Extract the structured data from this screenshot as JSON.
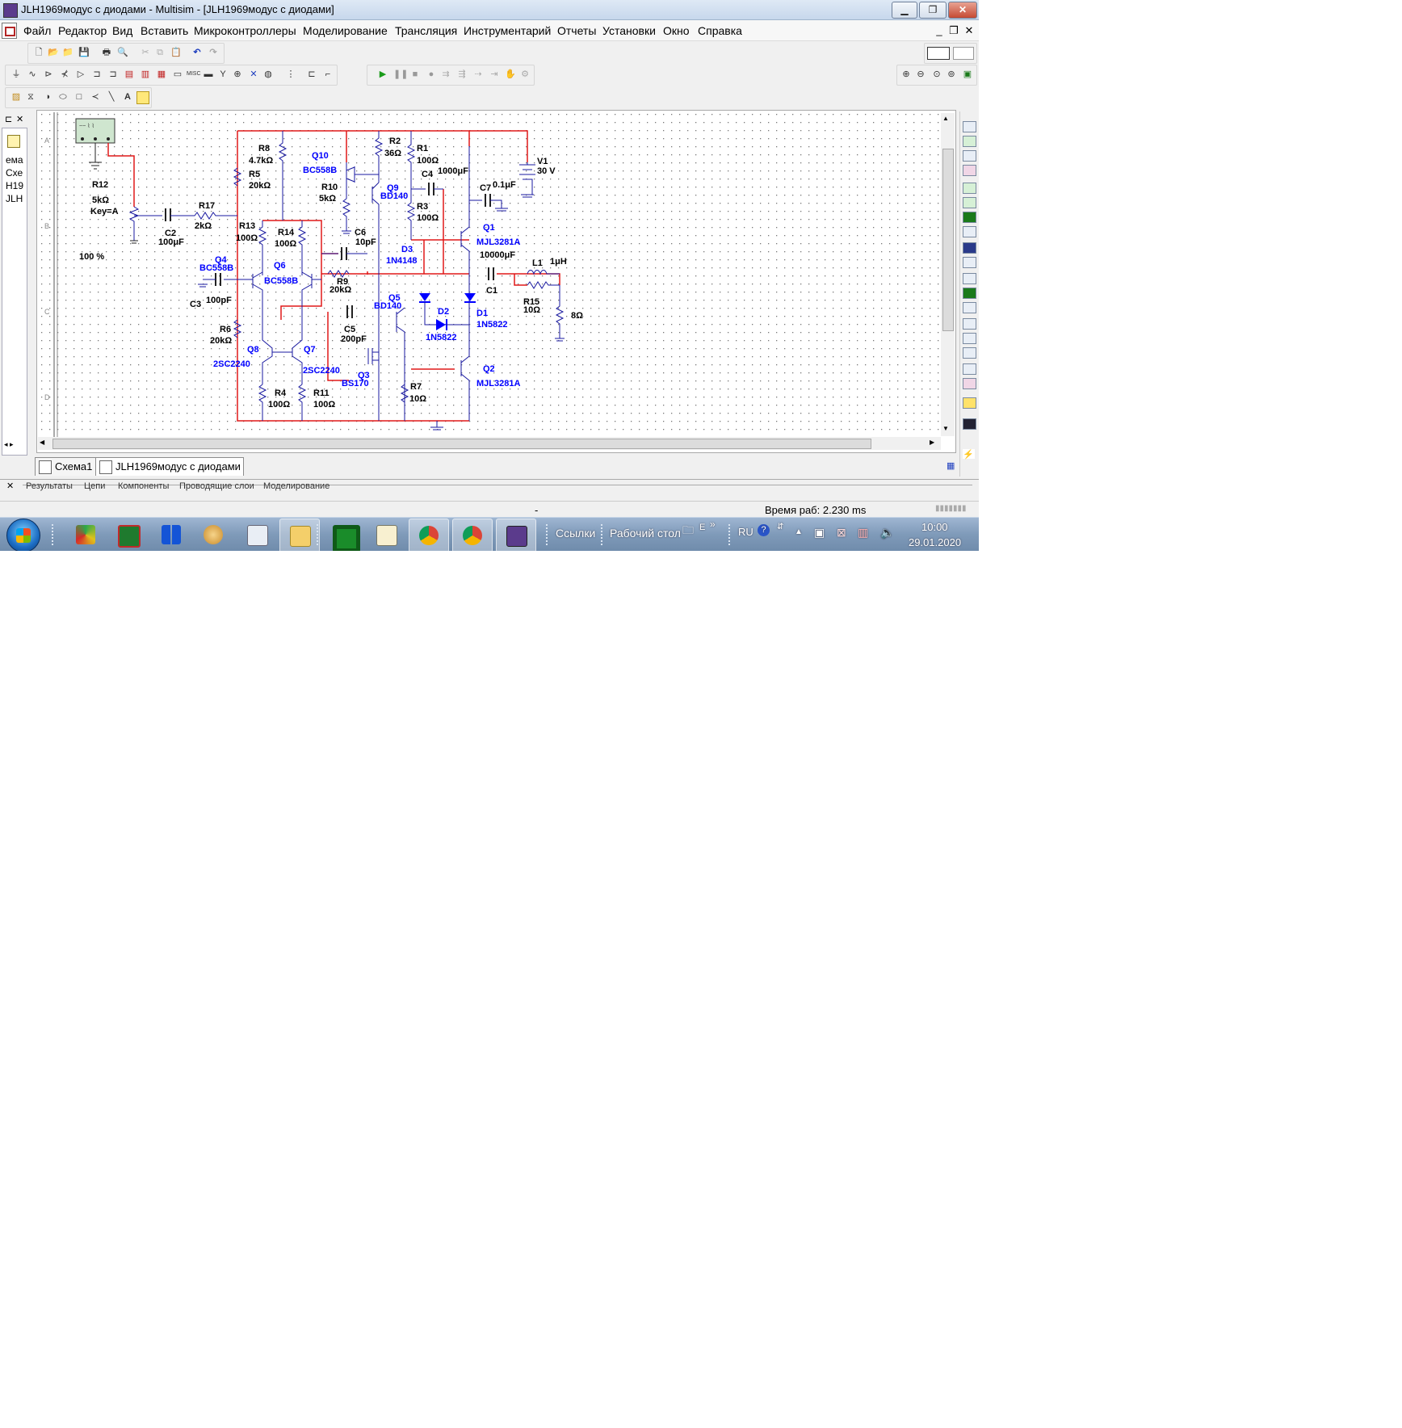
{
  "window": {
    "title": "JLH1969модус с диодами - Multisim - [JLH1969модус с диодами]",
    "minimize": "▁",
    "restore": "❐",
    "close": "✕"
  },
  "menu": {
    "items": [
      "Файл",
      "Редактор",
      "Вид",
      "Вставить",
      "Микроконтроллеры",
      "Моделирование",
      "Трансляция",
      "Инструментарий",
      "Отчеты",
      "Установки",
      "Окно",
      "Справка"
    ],
    "mdi_minimize": "_",
    "mdi_restore": "❐",
    "mdi_close": "✕"
  },
  "toolbar_icons": {
    "file": [
      "new-icon",
      "open-icon",
      "open-folder-icon",
      "save-icon",
      "print-icon",
      "print-preview-icon",
      "cut-icon",
      "copy-icon",
      "paste-icon",
      "undo-icon",
      "redo-icon"
    ],
    "simulation": [
      "run-icon",
      "pause-icon",
      "stop-icon",
      "record-icon"
    ],
    "colors": {
      "run": "#1a9b1a",
      "undo": "#1f3fbf",
      "accent_red": "#e01818",
      "wire_blue": "#0000ff"
    }
  },
  "left_panel": {
    "lines": [
      "ема",
      "Схе",
      "H19",
      "JLH"
    ]
  },
  "canvas": {
    "probe_percent": "100 %",
    "ruler_rows": [
      "A",
      "B",
      "C",
      "D"
    ]
  },
  "schematic": {
    "labels": [
      {
        "id": "R12",
        "t": "R12"
      },
      {
        "id": "R12v",
        "t": "5kΩ"
      },
      {
        "id": "R12k",
        "t": "Key=A"
      },
      {
        "id": "C2",
        "t": "C2"
      },
      {
        "id": "C2v",
        "t": "100μF"
      },
      {
        "id": "R17",
        "t": "R17"
      },
      {
        "id": "R17v",
        "t": "2kΩ"
      },
      {
        "id": "R8",
        "t": "R8"
      },
      {
        "id": "R8v",
        "t": "4.7kΩ"
      },
      {
        "id": "R5",
        "t": "R5"
      },
      {
        "id": "R5v",
        "t": "20kΩ"
      },
      {
        "id": "R13",
        "t": "R13"
      },
      {
        "id": "R13v",
        "t": "100Ω"
      },
      {
        "id": "R14",
        "t": "R14"
      },
      {
        "id": "R14v",
        "t": "100Ω"
      },
      {
        "id": "Q4",
        "t": "Q4"
      },
      {
        "id": "Q4v",
        "t": "BC558B"
      },
      {
        "id": "Q6",
        "t": "Q6"
      },
      {
        "id": "Q6v",
        "t": "BC558B"
      },
      {
        "id": "C3",
        "t": "C3"
      },
      {
        "id": "C3v",
        "t": "100pF"
      },
      {
        "id": "R6",
        "t": "R6"
      },
      {
        "id": "R6v",
        "t": "20kΩ"
      },
      {
        "id": "Q8",
        "t": "Q8"
      },
      {
        "id": "Q8v",
        "t": "2SC2240"
      },
      {
        "id": "Q7",
        "t": "Q7"
      },
      {
        "id": "Q7v",
        "t": "2SC2240"
      },
      {
        "id": "R4",
        "t": "R4"
      },
      {
        "id": "R4v",
        "t": "100Ω"
      },
      {
        "id": "R11",
        "t": "R11"
      },
      {
        "id": "R11v",
        "t": "100Ω"
      },
      {
        "id": "Q10",
        "t": "Q10"
      },
      {
        "id": "Q10v",
        "t": "BC558B"
      },
      {
        "id": "R10",
        "t": "R10"
      },
      {
        "id": "R10v",
        "t": "5kΩ"
      },
      {
        "id": "R2",
        "t": "R2"
      },
      {
        "id": "R2v",
        "t": "36Ω"
      },
      {
        "id": "Q9",
        "t": "Q9"
      },
      {
        "id": "Q9v",
        "t": "BD140"
      },
      {
        "id": "C6",
        "t": "C6"
      },
      {
        "id": "C6v",
        "t": "10pF"
      },
      {
        "id": "R9",
        "t": "R9"
      },
      {
        "id": "R9v",
        "t": "20kΩ"
      },
      {
        "id": "C5",
        "t": "C5"
      },
      {
        "id": "C5v",
        "t": "200pF"
      },
      {
        "id": "Q5",
        "t": "Q5"
      },
      {
        "id": "Q5v",
        "t": "BD140"
      },
      {
        "id": "Q3",
        "t": "Q3"
      },
      {
        "id": "Q3v",
        "t": "BS170"
      },
      {
        "id": "R1",
        "t": "R1"
      },
      {
        "id": "R1v",
        "t": "100Ω"
      },
      {
        "id": "C4",
        "t": "C4"
      },
      {
        "id": "C4v",
        "t": "1000μF"
      },
      {
        "id": "R3",
        "t": "R3"
      },
      {
        "id": "R3v",
        "t": "100Ω"
      },
      {
        "id": "D3",
        "t": "D3"
      },
      {
        "id": "D3v",
        "t": "1N4148"
      },
      {
        "id": "D2",
        "t": "D2"
      },
      {
        "id": "D2v",
        "t": "1N5822"
      },
      {
        "id": "R7",
        "t": "R7"
      },
      {
        "id": "R7v",
        "t": "10Ω"
      },
      {
        "id": "Q1",
        "t": "Q1"
      },
      {
        "id": "Q1v",
        "t": "MJL3281A"
      },
      {
        "id": "Q2",
        "t": "Q2"
      },
      {
        "id": "Q2v",
        "t": "MJL3281A"
      },
      {
        "id": "D1",
        "t": "D1"
      },
      {
        "id": "D1v",
        "t": "1N5822"
      },
      {
        "id": "C7",
        "t": "C7"
      },
      {
        "id": "C7v",
        "t": "0.1μF"
      },
      {
        "id": "V1",
        "t": "V1"
      },
      {
        "id": "V1v",
        "t": "30 V"
      },
      {
        "id": "C1",
        "t": "C1"
      },
      {
        "id": "C1v",
        "t": "10000μF"
      },
      {
        "id": "L1",
        "t": "L1"
      },
      {
        "id": "L1v",
        "t": "1μH"
      },
      {
        "id": "R15",
        "t": "R15"
      },
      {
        "id": "R15v",
        "t": "10Ω"
      },
      {
        "id": "RL",
        "t": "8Ω"
      }
    ]
  },
  "doc_tabs": [
    "Схема1",
    "JLH1969модус с диодами"
  ],
  "bottom_tabs": [
    "Результаты",
    "Цепи",
    "Компоненты",
    "Проводящие слои",
    "Моделирование"
  ],
  "status": {
    "dash": "-",
    "time": "Время раб: 2.230 ms"
  },
  "taskbar": {
    "toolbar_links": "Ссылки",
    "toolbar_desktop": "Рабочий стол",
    "desktop_short": "E",
    "more": "»",
    "lang": "RU",
    "clock_time": "10:00",
    "clock_date": "29.01.2020",
    "apps": [
      "kicad-icon",
      "multisim-chip-icon",
      "windows-tiles-icon",
      "paint-icon",
      "calculator-icon",
      "explorer-icon",
      "green-app-icon",
      "notepad-icon",
      "chrome-icon",
      "chrome-icon",
      "multisim-icon"
    ]
  }
}
